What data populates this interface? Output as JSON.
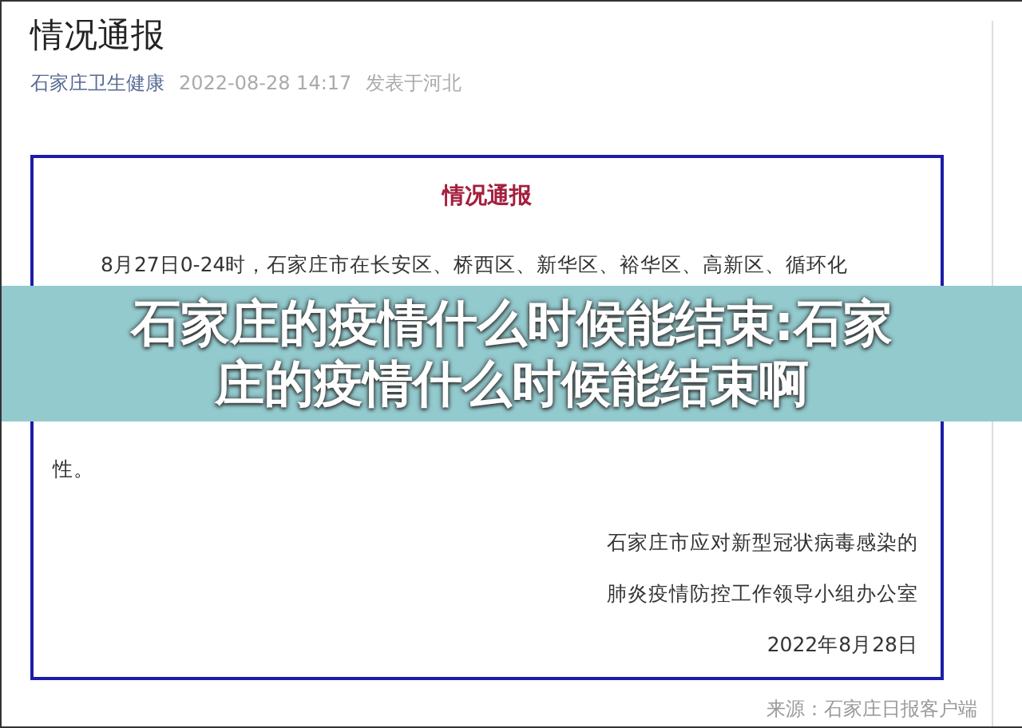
{
  "article": {
    "title": "情况通报",
    "author": "石家庄卫生健康",
    "time": "2022-08-28 14:17",
    "location": "发表于河北"
  },
  "notice": {
    "heading": "情况通报",
    "lines": [
      "8月27日0-24时，石家庄市在长安区、桥西区、新华区、裕华区、高新区、循环化",
      "性。"
    ],
    "signature": [
      "石家庄市应对新型冠状病毒感染的",
      "肺炎疫情防控工作领导小组办公室",
      "2022年8月28日"
    ]
  },
  "source": "来源：石家庄日报客户端",
  "banner": {
    "lines": [
      "石家庄的疫情什么时候能结束:石家",
      "庄的疫情什么时候能结束啊"
    ]
  }
}
